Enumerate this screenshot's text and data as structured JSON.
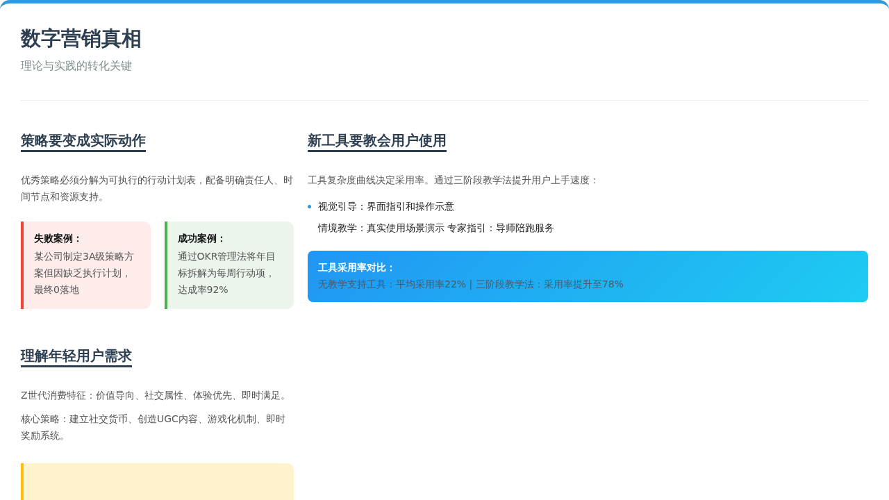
{
  "header": {
    "title": "数字营销真相",
    "subtitle": "理论与实践的转化关键"
  },
  "left_sections": [
    {
      "heading": "策略要变成实际动作",
      "paragraphs": [
        "优秀策略必须分解为可执行的行动计划表，配备明确责任人、时间节点和资源支持。"
      ],
      "cases": [
        {
          "kind": "failure",
          "color": "#f44336",
          "title": "失败案例：",
          "text": "某公司制定3A级策略方案但因缺乏执行计划，最终0落地"
        },
        {
          "kind": "success",
          "color": "#4caf50",
          "title": "成功案例：",
          "text": "通过OKR管理法将年目标拆解为每周行动项，达成率92%"
        }
      ]
    },
    {
      "heading": "理解年轻用户需求",
      "paragraphs": [
        "Z世代消费特征：价值导向、社交属性、体验优先、即时满足。",
        "核心策略：建立社交货币、创造UGC内容、游戏化机制、即时奖励系统。"
      ],
      "callout": {
        "kind": "note"
      }
    }
  ],
  "right_section": {
    "heading": "新工具要教会用户使用",
    "intro": "工具复杂度曲线决定采用率。通过三阶段教学法提升用户上手速度：",
    "items": [
      {
        "text": "视觉引导：界面指引和操作示意",
        "bulleted": true
      },
      {
        "text": "情境教学：真实使用场景演示 专家指引：导师陪跑服务",
        "bulleted": false
      }
    ],
    "highlight": {
      "title": "工具采用率对比：",
      "text": "无教学支持工具：平均采用率22% | 三阶段教学法：采用率提升至78%"
    }
  }
}
